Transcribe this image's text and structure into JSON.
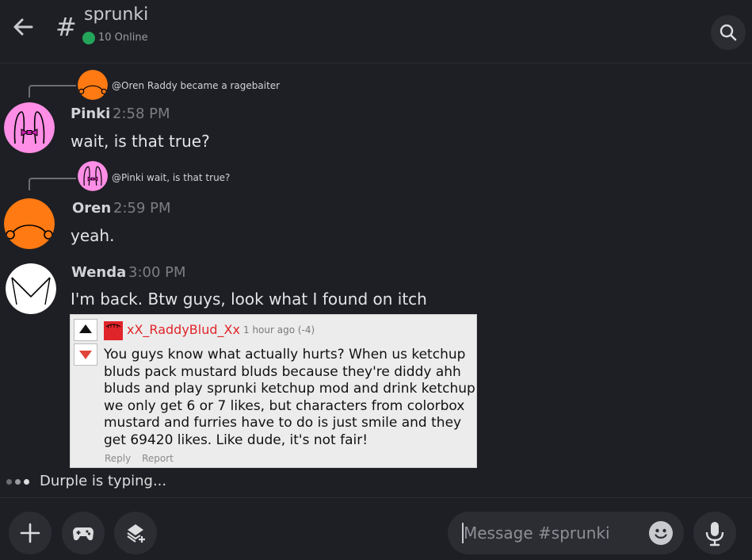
{
  "header": {
    "channel_hash": "#",
    "channel_name": "sprunki",
    "online_text": "10 Online"
  },
  "messages": [
    {
      "reply_text": "@Oren Raddy became a ragebaiter",
      "reply_avatar": "orange-avatar",
      "username": "Pinki",
      "time": "2:58 PM",
      "text": "wait, is that true?",
      "avatar": "pink-bow-avatar"
    },
    {
      "reply_text": "@Pinki wait, is that true?",
      "reply_avatar": "pink-bow-avatar",
      "username": "Oren",
      "time": "2:59 PM",
      "text": "yeah.",
      "avatar": "orange-avatar"
    },
    {
      "username": "Wenda",
      "time": "3:00 PM",
      "text": "I'm back. Btw guys, look what I found on itch",
      "avatar": "white-envelope-avatar"
    }
  ],
  "embed": {
    "username": "xX_RaddyBlud_Xx",
    "time": "1 hour ago (-4)",
    "body": "You guys know what actually hurts? When us ketchup bluds pack mustard bluds because they're diddy ahh bluds and play sprunki ketchup mod and drink ketchup we only get 6 or 7 likes, but characters from colorbox mustard and furries have to do is just smile and they get 69420 likes. Like dude, it's not fair!",
    "reply_label": "Reply",
    "report_label": "Report"
  },
  "typing_text": "Durple is typing...",
  "composer": {
    "placeholder": "Message #sprunki"
  },
  "colors": {
    "background": "#1e1f24",
    "online": "#23a55a",
    "pinki": "#ff8ee6",
    "oren": "#ff7a12",
    "embed_user": "#e0252a"
  },
  "icons": [
    "arrow-left-icon",
    "search-icon",
    "plus-icon",
    "gamepad-icon",
    "sticker-icon",
    "emoji-icon",
    "microphone-icon",
    "upvote-icon",
    "downvote-icon"
  ]
}
